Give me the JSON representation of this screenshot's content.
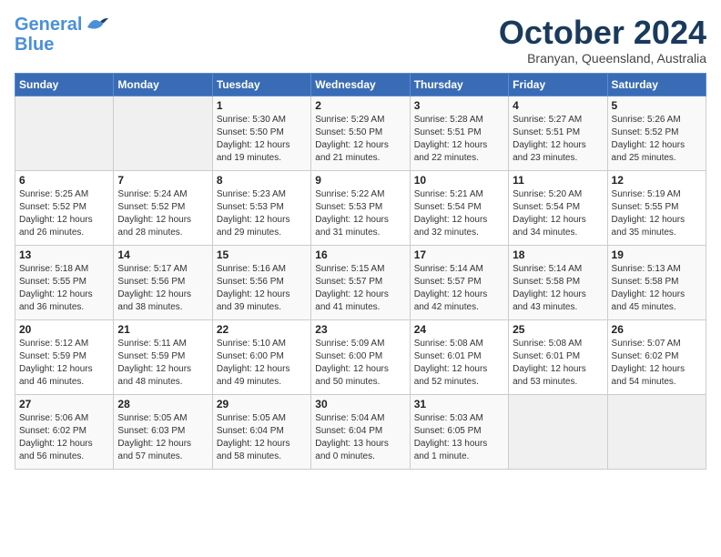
{
  "header": {
    "logo_line1": "General",
    "logo_line2": "Blue",
    "month_title": "October 2024",
    "subtitle": "Branyan, Queensland, Australia"
  },
  "weekdays": [
    "Sunday",
    "Monday",
    "Tuesday",
    "Wednesday",
    "Thursday",
    "Friday",
    "Saturday"
  ],
  "weeks": [
    [
      {
        "day": "",
        "info": ""
      },
      {
        "day": "",
        "info": ""
      },
      {
        "day": "1",
        "info": "Sunrise: 5:30 AM\nSunset: 5:50 PM\nDaylight: 12 hours\nand 19 minutes."
      },
      {
        "day": "2",
        "info": "Sunrise: 5:29 AM\nSunset: 5:50 PM\nDaylight: 12 hours\nand 21 minutes."
      },
      {
        "day": "3",
        "info": "Sunrise: 5:28 AM\nSunset: 5:51 PM\nDaylight: 12 hours\nand 22 minutes."
      },
      {
        "day": "4",
        "info": "Sunrise: 5:27 AM\nSunset: 5:51 PM\nDaylight: 12 hours\nand 23 minutes."
      },
      {
        "day": "5",
        "info": "Sunrise: 5:26 AM\nSunset: 5:52 PM\nDaylight: 12 hours\nand 25 minutes."
      }
    ],
    [
      {
        "day": "6",
        "info": "Sunrise: 5:25 AM\nSunset: 5:52 PM\nDaylight: 12 hours\nand 26 minutes."
      },
      {
        "day": "7",
        "info": "Sunrise: 5:24 AM\nSunset: 5:52 PM\nDaylight: 12 hours\nand 28 minutes."
      },
      {
        "day": "8",
        "info": "Sunrise: 5:23 AM\nSunset: 5:53 PM\nDaylight: 12 hours\nand 29 minutes."
      },
      {
        "day": "9",
        "info": "Sunrise: 5:22 AM\nSunset: 5:53 PM\nDaylight: 12 hours\nand 31 minutes."
      },
      {
        "day": "10",
        "info": "Sunrise: 5:21 AM\nSunset: 5:54 PM\nDaylight: 12 hours\nand 32 minutes."
      },
      {
        "day": "11",
        "info": "Sunrise: 5:20 AM\nSunset: 5:54 PM\nDaylight: 12 hours\nand 34 minutes."
      },
      {
        "day": "12",
        "info": "Sunrise: 5:19 AM\nSunset: 5:55 PM\nDaylight: 12 hours\nand 35 minutes."
      }
    ],
    [
      {
        "day": "13",
        "info": "Sunrise: 5:18 AM\nSunset: 5:55 PM\nDaylight: 12 hours\nand 36 minutes."
      },
      {
        "day": "14",
        "info": "Sunrise: 5:17 AM\nSunset: 5:56 PM\nDaylight: 12 hours\nand 38 minutes."
      },
      {
        "day": "15",
        "info": "Sunrise: 5:16 AM\nSunset: 5:56 PM\nDaylight: 12 hours\nand 39 minutes."
      },
      {
        "day": "16",
        "info": "Sunrise: 5:15 AM\nSunset: 5:57 PM\nDaylight: 12 hours\nand 41 minutes."
      },
      {
        "day": "17",
        "info": "Sunrise: 5:14 AM\nSunset: 5:57 PM\nDaylight: 12 hours\nand 42 minutes."
      },
      {
        "day": "18",
        "info": "Sunrise: 5:14 AM\nSunset: 5:58 PM\nDaylight: 12 hours\nand 43 minutes."
      },
      {
        "day": "19",
        "info": "Sunrise: 5:13 AM\nSunset: 5:58 PM\nDaylight: 12 hours\nand 45 minutes."
      }
    ],
    [
      {
        "day": "20",
        "info": "Sunrise: 5:12 AM\nSunset: 5:59 PM\nDaylight: 12 hours\nand 46 minutes."
      },
      {
        "day": "21",
        "info": "Sunrise: 5:11 AM\nSunset: 5:59 PM\nDaylight: 12 hours\nand 48 minutes."
      },
      {
        "day": "22",
        "info": "Sunrise: 5:10 AM\nSunset: 6:00 PM\nDaylight: 12 hours\nand 49 minutes."
      },
      {
        "day": "23",
        "info": "Sunrise: 5:09 AM\nSunset: 6:00 PM\nDaylight: 12 hours\nand 50 minutes."
      },
      {
        "day": "24",
        "info": "Sunrise: 5:08 AM\nSunset: 6:01 PM\nDaylight: 12 hours\nand 52 minutes."
      },
      {
        "day": "25",
        "info": "Sunrise: 5:08 AM\nSunset: 6:01 PM\nDaylight: 12 hours\nand 53 minutes."
      },
      {
        "day": "26",
        "info": "Sunrise: 5:07 AM\nSunset: 6:02 PM\nDaylight: 12 hours\nand 54 minutes."
      }
    ],
    [
      {
        "day": "27",
        "info": "Sunrise: 5:06 AM\nSunset: 6:02 PM\nDaylight: 12 hours\nand 56 minutes."
      },
      {
        "day": "28",
        "info": "Sunrise: 5:05 AM\nSunset: 6:03 PM\nDaylight: 12 hours\nand 57 minutes."
      },
      {
        "day": "29",
        "info": "Sunrise: 5:05 AM\nSunset: 6:04 PM\nDaylight: 12 hours\nand 58 minutes."
      },
      {
        "day": "30",
        "info": "Sunrise: 5:04 AM\nSunset: 6:04 PM\nDaylight: 13 hours\nand 0 minutes."
      },
      {
        "day": "31",
        "info": "Sunrise: 5:03 AM\nSunset: 6:05 PM\nDaylight: 13 hours\nand 1 minute."
      },
      {
        "day": "",
        "info": ""
      },
      {
        "day": "",
        "info": ""
      }
    ]
  ]
}
